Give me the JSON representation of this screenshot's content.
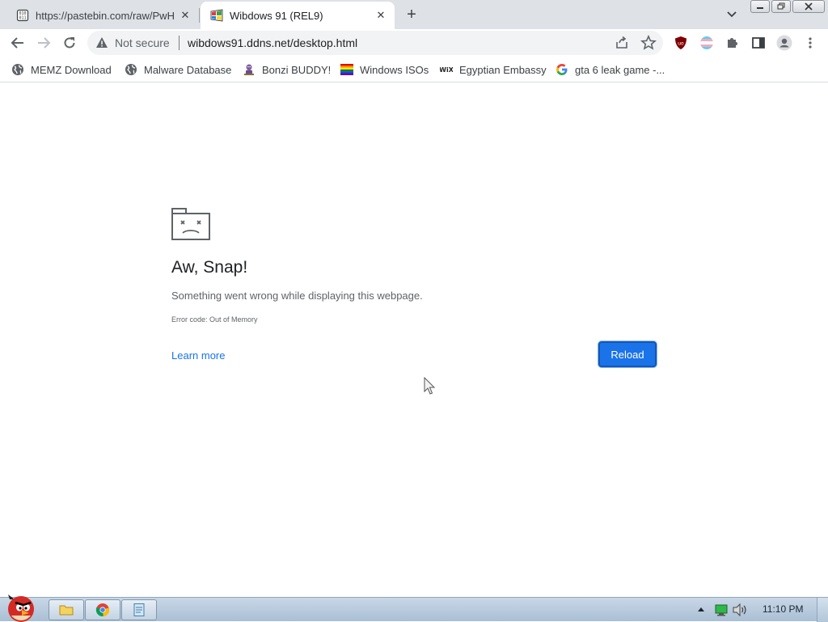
{
  "tabs": [
    {
      "title": "https://pastebin.com/raw/PwH",
      "active": false
    },
    {
      "title": "Wibdows 91 (REL9)",
      "active": true
    }
  ],
  "toolbar": {
    "security_label": "Not secure",
    "url": "wibdows91.ddns.net/desktop.html"
  },
  "bookmarks": [
    {
      "label": "MEMZ Download",
      "icon": "globe-icon"
    },
    {
      "label": "Malware Database",
      "icon": "globe-icon"
    },
    {
      "label": "Bonzi BUDDY!",
      "icon": "bonzi-icon"
    },
    {
      "label": "Windows ISOs",
      "icon": "rainbow-flag-icon"
    },
    {
      "label": "Egyptian Embassy",
      "icon": "wix-icon"
    },
    {
      "label": "gta 6 leak game -...",
      "icon": "google-icon"
    }
  ],
  "error": {
    "title": "Aw, Snap!",
    "message": "Something went wrong while displaying this webpage.",
    "code": "Error code: Out of Memory",
    "learn_more": "Learn more",
    "reload": "Reload"
  },
  "taskbar": {
    "clock": "11:10 PM"
  },
  "colors": {
    "accent": "#1a73e8",
    "tabstrip": "#dee1e6",
    "taskbar": "#b7c9dc"
  }
}
